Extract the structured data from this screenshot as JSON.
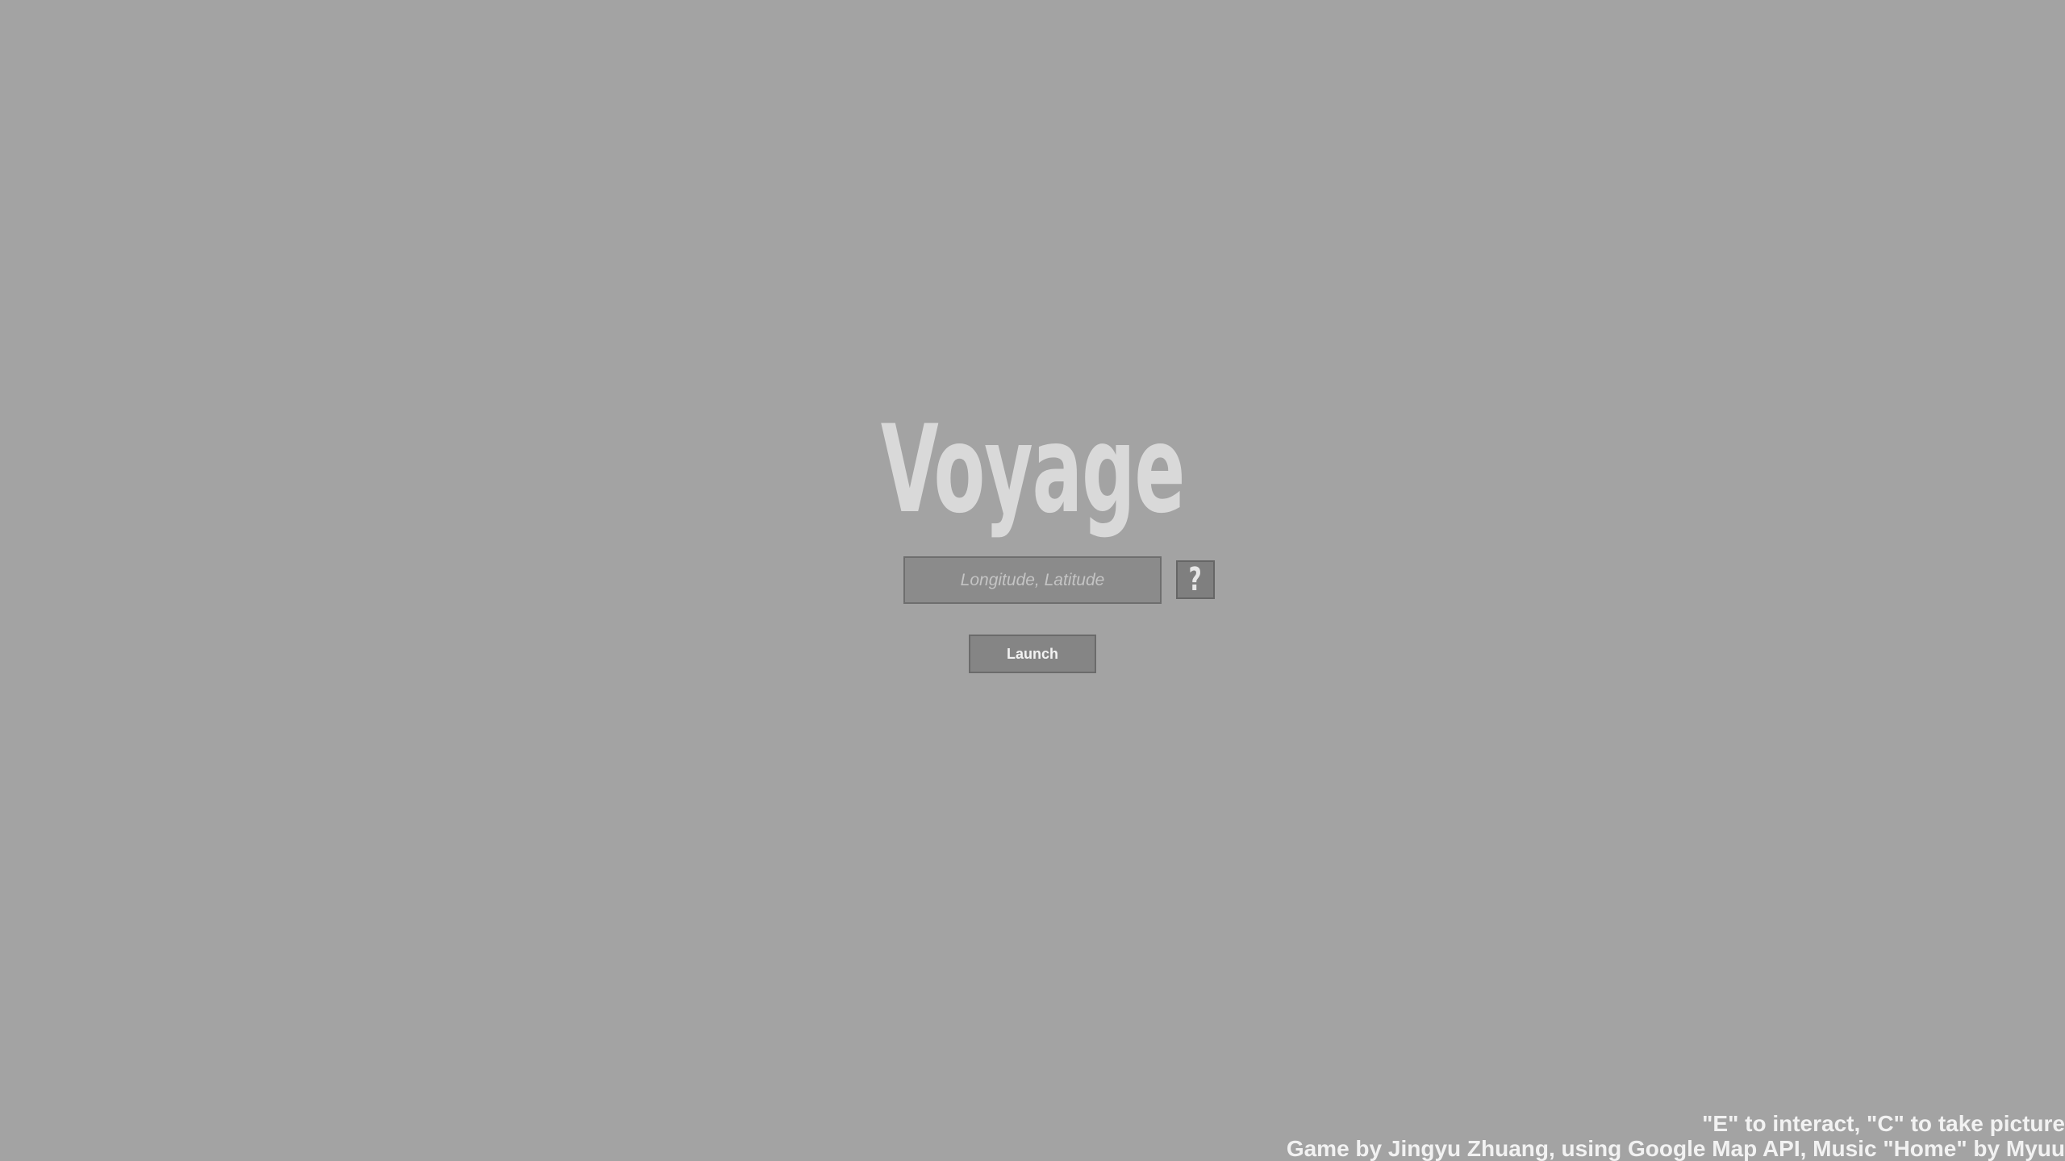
{
  "app": {
    "title": "Voyage"
  },
  "search": {
    "placeholder": "Longitude, Latitude",
    "value": ""
  },
  "help_button": {
    "label": "?",
    "icon": "question-icon"
  },
  "launch_button": {
    "label": "Launch"
  },
  "footer": {
    "controls": "\"E\" to interact, \"C\" to take picture",
    "credits": "Game by Jingyu Zhuang, using Google Map API, Music \"Home\" by Myuu"
  },
  "colors": {
    "background": "#a3a3a3",
    "title": "#d9d9d9",
    "input_bg": "#8b8b8b",
    "button_bg": "#858585",
    "text_light": "#f2f2f2"
  }
}
